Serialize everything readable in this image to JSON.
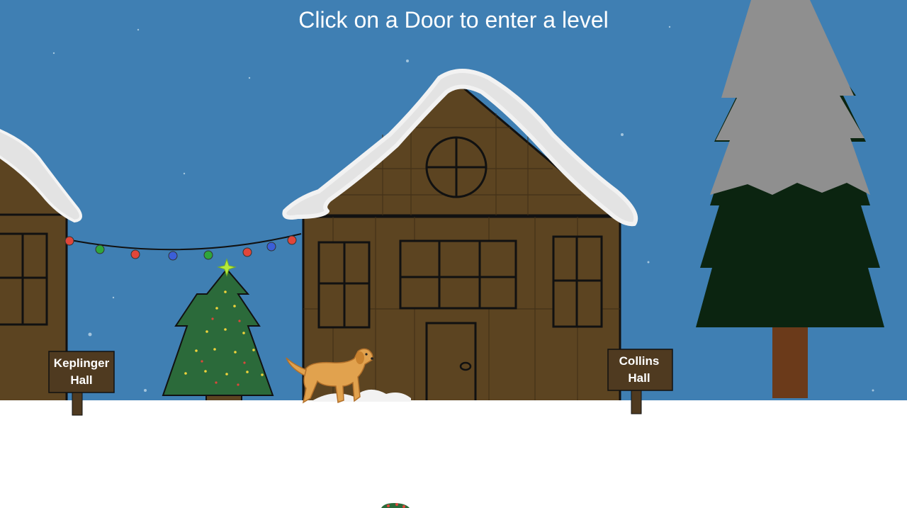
{
  "header": {
    "instruction": "Click on a Door to enter a level"
  },
  "signs": {
    "left": {
      "line1": "Keplinger",
      "line2": "Hall"
    },
    "right": {
      "line1": "Collins",
      "line2": "Hall"
    }
  },
  "colors": {
    "sky": "#3f7fb3",
    "snow": "#ffffff",
    "snow_roof": "#e3e3e3",
    "house_wall": "#5c4421",
    "sign_wood": "#4f3a20",
    "pine": "#0b2410",
    "pine_snow": "#8f8f8f",
    "trunk": "#6b3a1a",
    "xmas_tree": "#2b6a3a",
    "dog": "#e1a24e"
  },
  "icons": {
    "dog": "golden-retriever-icon",
    "wreath": "wreath-icon",
    "star": "tree-star-icon"
  }
}
